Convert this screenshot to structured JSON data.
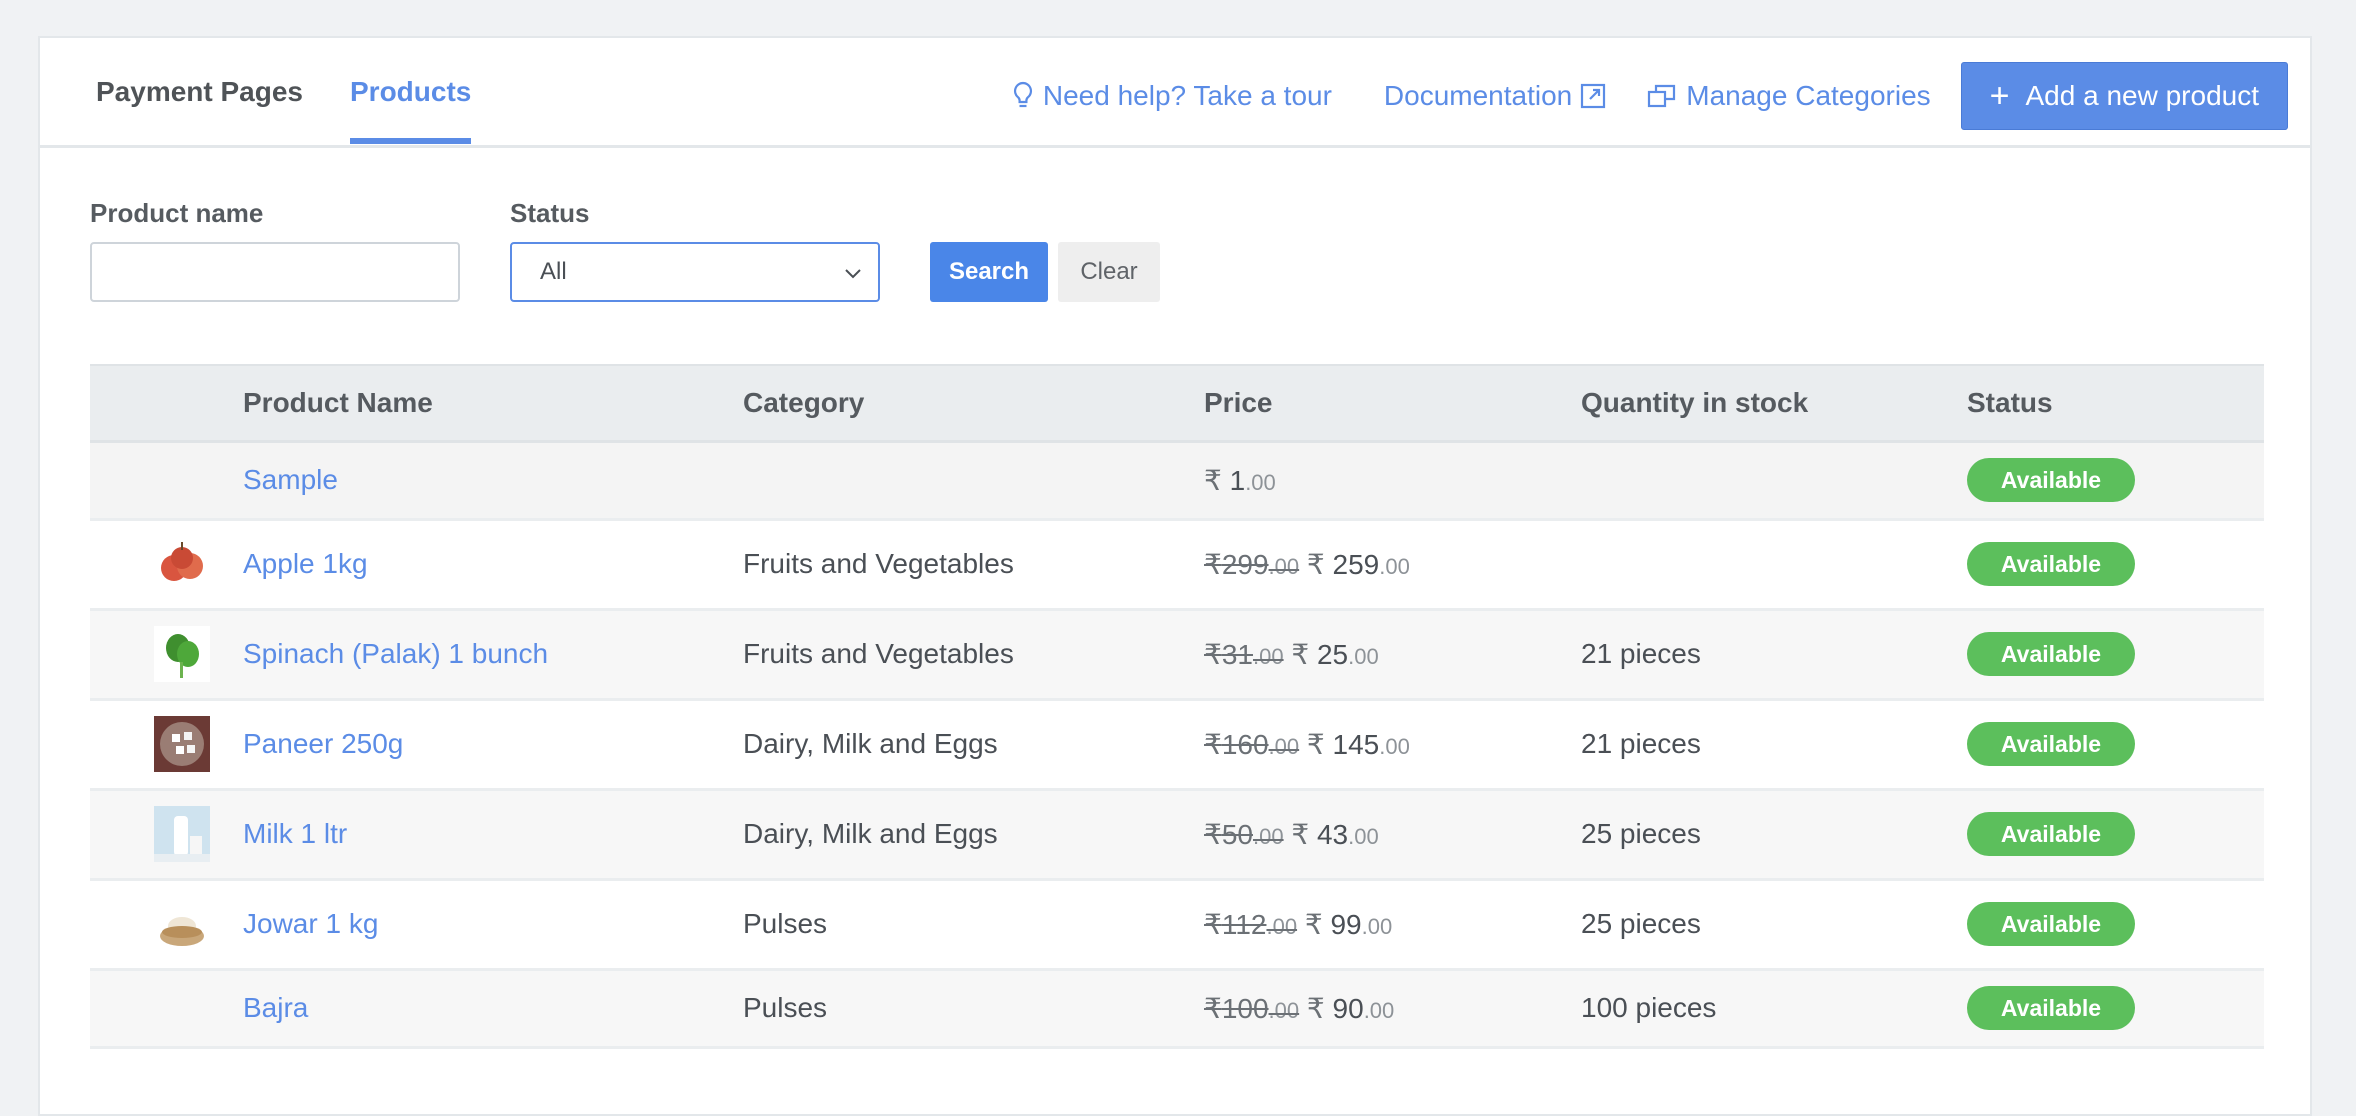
{
  "tabs": [
    {
      "label": "Payment Pages",
      "active": false
    },
    {
      "label": "Products",
      "active": true
    }
  ],
  "header_actions": {
    "tour_label": "Need help? Take a tour",
    "docs_label": "Documentation",
    "categories_label": "Manage Categories",
    "add_label": "Add a new product"
  },
  "filters": {
    "product_name_label": "Product name",
    "product_name_value": "",
    "status_label": "Status",
    "status_value": "All",
    "search_label": "Search",
    "clear_label": "Clear"
  },
  "table": {
    "columns": [
      "",
      "Product Name",
      "Category",
      "Price",
      "Quantity in stock",
      "Status"
    ],
    "currency": "₹",
    "rows": [
      {
        "image": "none",
        "name": "Sample",
        "category": "",
        "old_price": "",
        "old_dec": "",
        "price": "1",
        "price_dec": ".00",
        "qty": "",
        "status": "Available"
      },
      {
        "image": "apple",
        "name": "Apple 1kg",
        "category": "Fruits and Vegetables",
        "old_price": "299",
        "old_dec": ".00",
        "price": "259",
        "price_dec": ".00",
        "qty": "",
        "status": "Available"
      },
      {
        "image": "spinach",
        "name": "Spinach (Palak) 1 bunch",
        "category": "Fruits and Vegetables",
        "old_price": "31",
        "old_dec": ".00",
        "price": "25",
        "price_dec": ".00",
        "qty": "21 pieces",
        "status": "Available"
      },
      {
        "image": "paneer",
        "name": "Paneer 250g",
        "category": "Dairy, Milk and Eggs",
        "old_price": "160",
        "old_dec": ".00",
        "price": "145",
        "price_dec": ".00",
        "qty": "21 pieces",
        "status": "Available"
      },
      {
        "image": "milk",
        "name": "Milk 1 ltr",
        "category": "Dairy, Milk and Eggs",
        "old_price": "50",
        "old_dec": ".00",
        "price": "43",
        "price_dec": ".00",
        "qty": "25 pieces",
        "status": "Available"
      },
      {
        "image": "jowar",
        "name": "Jowar 1 kg",
        "category": "Pulses",
        "old_price": "112",
        "old_dec": ".00",
        "price": "99",
        "price_dec": ".00",
        "qty": "25 pieces",
        "status": "Available"
      },
      {
        "image": "none",
        "name": "Bajra",
        "category": "Pulses",
        "old_price": "100",
        "old_dec": ".00",
        "price": "90",
        "price_dec": ".00",
        "qty": "100 pieces",
        "status": "Available"
      }
    ]
  },
  "colors": {
    "accent": "#5b8ce6",
    "status_available": "#5cbf5c"
  }
}
